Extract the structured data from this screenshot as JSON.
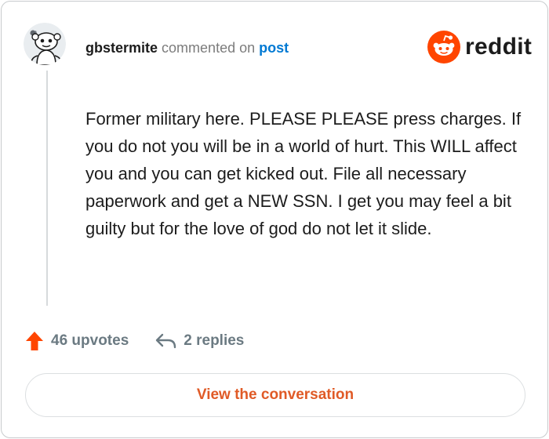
{
  "comment": {
    "author": "gbstermite",
    "action_text": "commented on",
    "target_text": "post",
    "body": "Former military here. PLEASE PLEASE press charges. If you do not you will be in a world of hurt. This WILL affect you and you can get kicked out. File all necessary paperwork and get a NEW SSN. I get you may feel a bit guilty but for the love of god do not let it slide."
  },
  "brand": {
    "wordmark": "reddit",
    "accent_color": "#ff4500"
  },
  "stats": {
    "upvotes_label": "46 upvotes",
    "replies_label": "2 replies"
  },
  "cta": {
    "label": "View the conversation"
  },
  "icons": {
    "avatar": "snoo-avatar",
    "logo": "reddit-logo-icon",
    "upvote": "upvote-arrow-icon",
    "reply": "reply-arrow-icon"
  }
}
